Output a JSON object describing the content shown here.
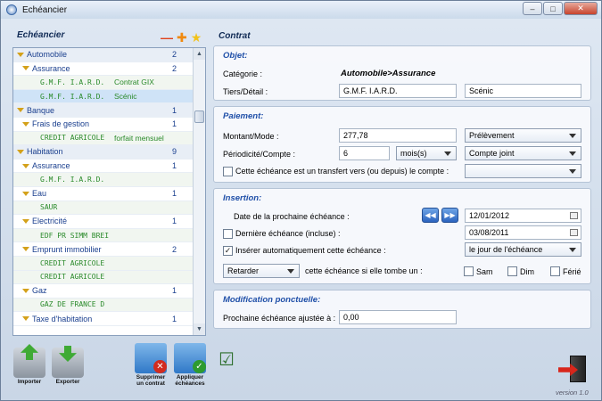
{
  "window": {
    "title": "Echéancier"
  },
  "left": {
    "title": "Echéancier",
    "tree": [
      {
        "level": 0,
        "label": "Automobile",
        "count": "2"
      },
      {
        "level": 1,
        "label": "Assurance",
        "count": "2"
      },
      {
        "level": 2,
        "label": "G.M.F. I.A.R.D.",
        "detail": "Contrat GIX"
      },
      {
        "level": 2,
        "label": "G.M.F. I.A.R.D.",
        "detail": "Scénic",
        "selected": true
      },
      {
        "level": 0,
        "label": "Banque",
        "count": "1"
      },
      {
        "level": 1,
        "label": "Frais de gestion",
        "count": "1"
      },
      {
        "level": 2,
        "label": "CREDIT AGRICOLE",
        "detail": "forfait mensuel"
      },
      {
        "level": 0,
        "label": "Habitation",
        "count": "9"
      },
      {
        "level": 1,
        "label": "Assurance",
        "count": "1"
      },
      {
        "level": 2,
        "label": "G.M.F. I.A.R.D.",
        "detail": ""
      },
      {
        "level": 1,
        "label": "Eau",
        "count": "1"
      },
      {
        "level": 2,
        "label": "SAUR",
        "detail": ""
      },
      {
        "level": 1,
        "label": "Electricité",
        "count": "1"
      },
      {
        "level": 2,
        "label": "EDF PR SIMM BREI",
        "detail": ""
      },
      {
        "level": 1,
        "label": "Emprunt immobilier",
        "count": "2"
      },
      {
        "level": 2,
        "label": "CREDIT AGRICOLE",
        "detail": ""
      },
      {
        "level": 2,
        "label": "CREDIT AGRICOLE",
        "detail": ""
      },
      {
        "level": 1,
        "label": "Gaz",
        "count": "1"
      },
      {
        "level": 2,
        "label": "GAZ DE FRANCE D",
        "detail": ""
      },
      {
        "level": 1,
        "label": "Taxe d'habitation",
        "count": "1"
      }
    ]
  },
  "toolbar": {
    "import": "Importer",
    "export": "Exporter",
    "delete_line1": "Supprimer",
    "delete_line2": "un contrat",
    "apply_line1": "Appliquer",
    "apply_line2": "échéances"
  },
  "contract": {
    "title": "Contrat",
    "objet": {
      "title": "Objet:",
      "categorie_label": "Catégorie :",
      "categorie_value": "Automobile>Assurance",
      "tiers_label": "Tiers/Détail :",
      "tiers_value": "G.M.F. I.A.R.D.",
      "detail_value": "Scénic"
    },
    "paiement": {
      "title": "Paiement:",
      "montant_label": "Montant/Mode :",
      "montant_value": "277,78",
      "mode_value": "Prélèvement",
      "periodicite_label": "Périodicité/Compte :",
      "periodicite_value": "6",
      "unite_value": "mois(s)",
      "compte_value": "Compte joint",
      "transfert_label": "Cette échéance est un transfert vers (ou depuis) le compte :",
      "transfert_value": ""
    },
    "insertion": {
      "title": "Insertion:",
      "prochaine_label": "Date de la prochaine échéance :",
      "prochaine_value": "12/01/2012",
      "derniere_label": "Dernière échéance (incluse) :",
      "derniere_value": "03/08/2011",
      "auto_label": "Insérer automatiquement cette échéance :",
      "auto_value": "le jour de l'échéance",
      "retarder_value": "Retarder",
      "tombe_label": "cette échéance si elle tombe un :",
      "sam": "Sam",
      "dim": "Dim",
      "ferie": "Férié"
    },
    "modification": {
      "title": "Modification ponctuelle:",
      "ajustee_label": "Prochaine échéance ajustée à :",
      "ajustee_value": "0,00"
    }
  },
  "footer": {
    "version": "version 1.0"
  }
}
